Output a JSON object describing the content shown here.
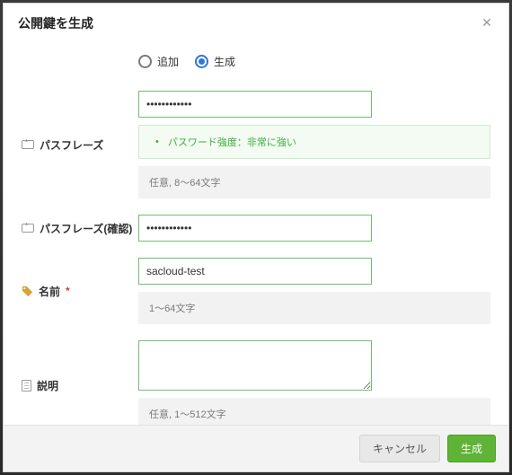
{
  "header": {
    "title": "公開鍵を生成"
  },
  "mode": {
    "add_label": "追加",
    "generate_label": "生成"
  },
  "passphrase": {
    "label": "パスフレーズ",
    "value": "••••••••••••",
    "strength_msg": "パスワード強度：非常に強い",
    "hint": "任意, 8〜64文字"
  },
  "passphrase_confirm": {
    "label": "パスフレーズ(確認)",
    "value": "••••••••••••"
  },
  "name": {
    "label": "名前",
    "value": "sacloud-test",
    "hint": "1〜64文字"
  },
  "description": {
    "label": "説明",
    "value": "",
    "hint": "任意, 1〜512文字"
  },
  "footer": {
    "cancel": "キャンセル",
    "submit": "生成"
  }
}
